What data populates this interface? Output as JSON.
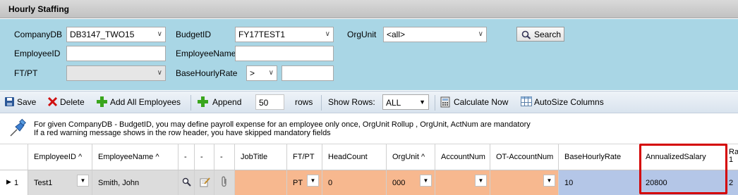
{
  "title": "Hourly Staffing",
  "filters": {
    "company_label": "CompanyDB",
    "company_value": "DB3147_TWO15",
    "budget_label": "BudgetID",
    "budget_value": "FY17TEST1",
    "orgunit_label": "OrgUnit",
    "orgunit_value": "<all>",
    "search_label": "Search",
    "employeeid_label": "EmployeeID",
    "employeeid_value": "",
    "employeename_label": "EmployeeName",
    "employeename_value": "",
    "ftpt_label": "FT/PT",
    "ftpt_value": "",
    "rate_label": "BaseHourlyRate",
    "rate_op": ">",
    "rate_value": ""
  },
  "toolbar": {
    "save": "Save",
    "delete": "Delete",
    "add_all": "Add All Employees",
    "append": "Append",
    "rows_value": "50",
    "rows_label": "rows",
    "show_rows_label": "Show Rows:",
    "show_rows_value": "ALL",
    "calculate": "Calculate Now",
    "autosize": "AutoSize Columns"
  },
  "info": {
    "line1": "For given CompanyDB - BudgetID, you may define payroll expense for an employee only once, OrgUnit Rollup , OrgUnit, ActNum are mandatory",
    "line2": "If a red warning message shows in the row header, you have skipped mandatory fields"
  },
  "grid": {
    "headers": [
      "EmployeeID ^",
      "EmployeeName ^",
      "-",
      "-",
      "-",
      "JobTitle",
      "FT/PT",
      "HeadCount",
      "OrgUnit ^",
      "AccountNum",
      "OT-AccountNum",
      "BaseHourlyRate",
      "AnnualizedSalary",
      "Ra 1"
    ],
    "row": {
      "num": "1",
      "employee_id": "Test1",
      "employee_name": "Smith, John",
      "job_title": "",
      "ftpt": "PT",
      "headcount": "0",
      "orgunit": "000",
      "account": "",
      "ot_account": "",
      "base_rate": "10",
      "annualized": "20800",
      "ra": "2"
    }
  },
  "colors": {
    "filter_bg": "#a9d6e5",
    "peach": "#f7b88f",
    "blue": "#b4c6e7",
    "highlight": "#d40000"
  }
}
